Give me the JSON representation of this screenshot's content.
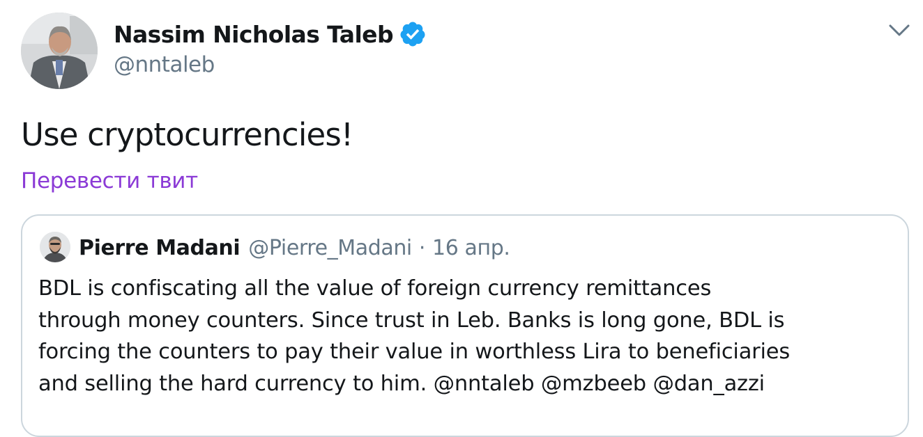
{
  "tweet": {
    "author": {
      "name": "Nassim Nicholas Taleb",
      "handle": "@nntaleb",
      "verified": true,
      "avatar_icon": "profile-photo"
    },
    "text": "Use cryptocurrencies!",
    "translate_link": "Перевести твит",
    "menu_icon": "chevron-down-icon"
  },
  "quoted_tweet": {
    "author": {
      "name": "Pierre Madani",
      "handle": "@Pierre_Madani",
      "avatar_icon": "profile-photo"
    },
    "separator": "·",
    "date": "16 апр.",
    "lines": [
      "BDL is confiscating all the value of foreign currency remittances",
      "through money counters. Since trust in Leb. Banks is long gone, BDL is",
      "forcing the counters to pay their value in worthless Lira to beneficiaries",
      "and selling the hard currency to him. @nntaleb @mzbeeb @dan_azzi"
    ]
  },
  "colors": {
    "text": "#14171a",
    "secondary": "#657786",
    "translate_link": "#8b3ad6",
    "verified_badge": "#1da1f2",
    "quote_border": "#ccd6dd"
  }
}
